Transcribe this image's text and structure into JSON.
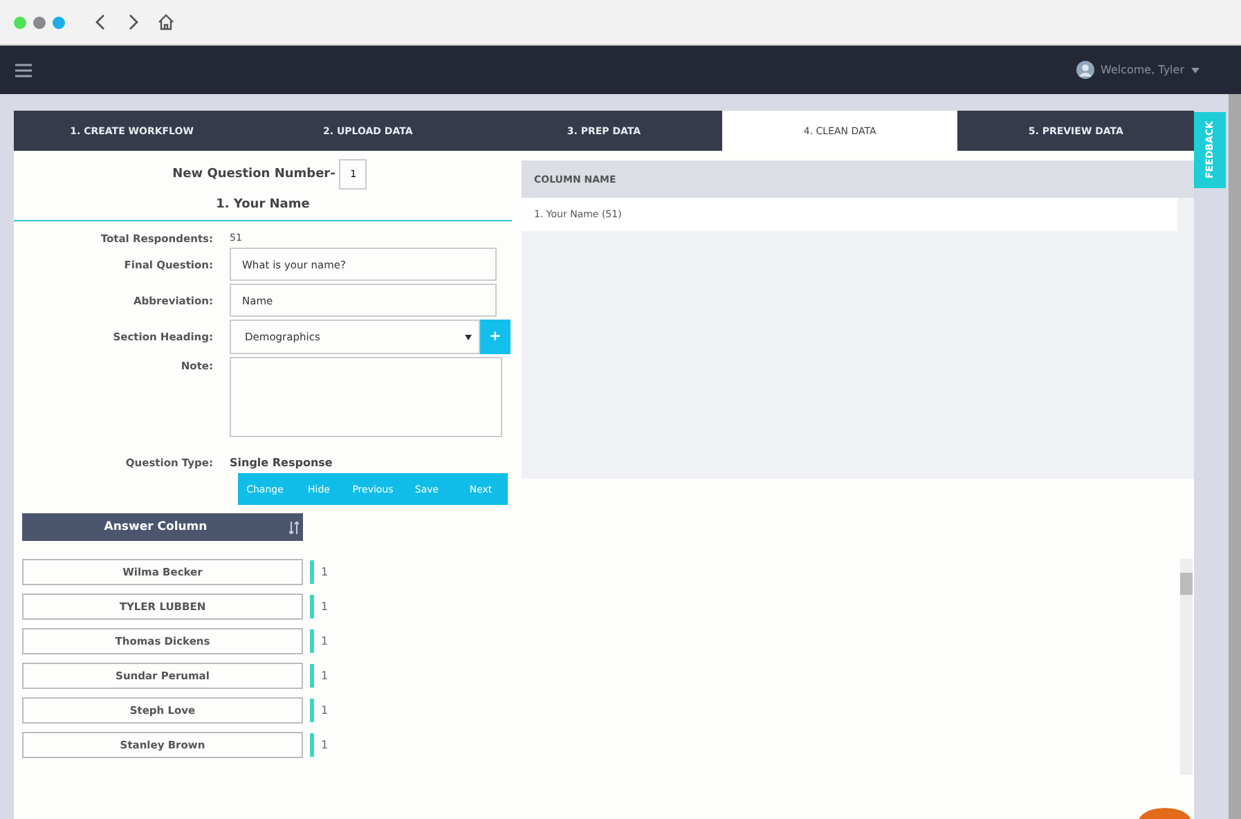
{
  "header": {
    "welcome": "Welcome, Tyler"
  },
  "tabs": [
    {
      "label": "1. CREATE WORKFLOW",
      "selected": false
    },
    {
      "label": "2. UPLOAD DATA",
      "selected": false
    },
    {
      "label": "3. PREP DATA",
      "selected": false
    },
    {
      "label": "4. CLEAN DATA",
      "selected": true
    },
    {
      "label": "5. PREVIEW DATA",
      "selected": false
    }
  ],
  "feedback": "FEEDBACK",
  "question": {
    "number_label": "New Question Number-",
    "number": "1",
    "title": "1. Your Name",
    "fields": [
      {
        "kind": "text",
        "label": "Total Respondents:",
        "value": "51"
      },
      {
        "kind": "input",
        "label": "Final Question:",
        "value": "What is your name?"
      },
      {
        "kind": "input",
        "label": "Abbreviation:",
        "value": "Name"
      },
      {
        "kind": "select",
        "label": "Section Heading:",
        "value": "Demographics",
        "add": "+"
      },
      {
        "kind": "textarea",
        "label": "Note:"
      },
      {
        "kind": "text",
        "label": "Question Type:",
        "value": "Single Response"
      }
    ],
    "buttons": [
      "Change",
      "Hide",
      "Previous",
      "Save",
      "Next"
    ]
  },
  "answer_column": {
    "title": "Answer Column",
    "rows": [
      {
        "answer": "Wilma Becker",
        "count": "1"
      },
      {
        "answer": "TYLER LUBBEN",
        "count": "1"
      },
      {
        "answer": "Thomas Dickens",
        "count": "1"
      },
      {
        "answer": "Sundar Perumal",
        "count": "1"
      },
      {
        "answer": "Steph Love",
        "count": "1"
      },
      {
        "answer": "Stanley Brown",
        "count": "1"
      }
    ]
  },
  "column_table": {
    "heading": "COLUMN NAME",
    "rows": [
      "1. Your Name (51)"
    ]
  }
}
